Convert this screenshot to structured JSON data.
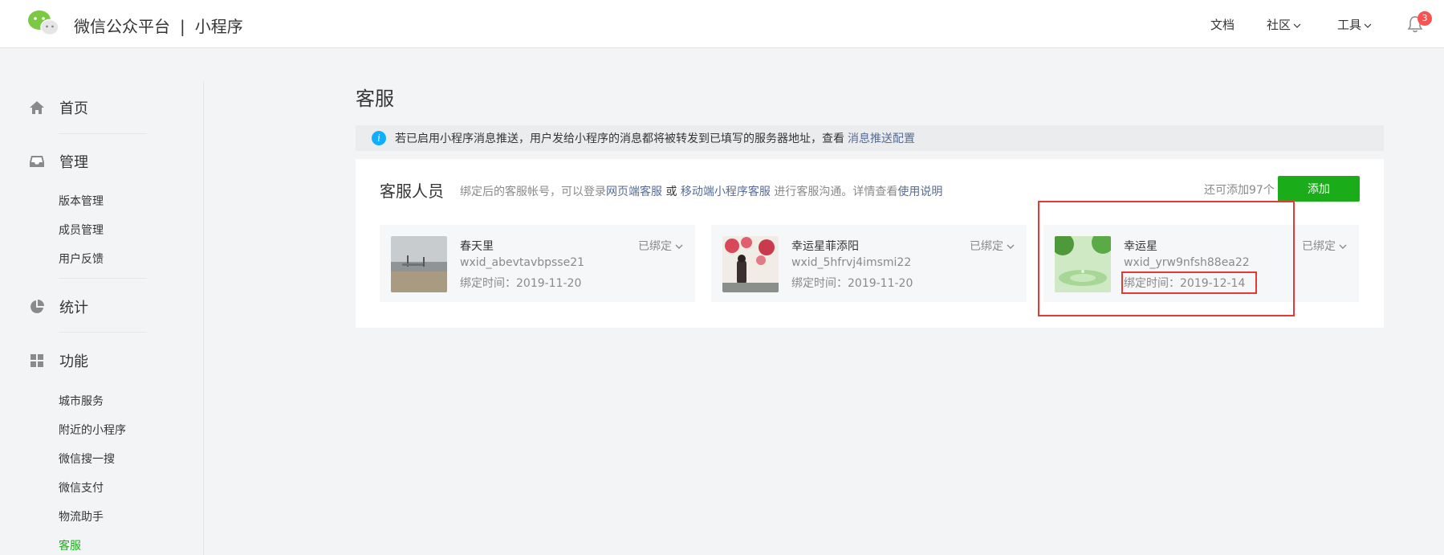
{
  "header": {
    "brand_name": "微信公众平台",
    "separator": "|",
    "product": "小程序",
    "nav": [
      "文档",
      "社区",
      "工具"
    ],
    "notification_count": "3"
  },
  "sidebar": {
    "sections": [
      {
        "label": "首页",
        "icon": "home-icon"
      },
      {
        "label": "管理",
        "icon": "inbox-icon",
        "items": [
          "版本管理",
          "成员管理",
          "用户反馈"
        ]
      },
      {
        "label": "统计",
        "icon": "pie-chart-icon"
      },
      {
        "label": "功能",
        "icon": "grid-icon",
        "items": [
          "城市服务",
          "附近的小程序",
          "微信搜一搜",
          "微信支付",
          "物流助手",
          "客服"
        ]
      }
    ],
    "active_item": "客服"
  },
  "main": {
    "title": "客服",
    "notice": {
      "text": "若已启用小程序消息推送，用户发给小程序的消息都将被转发到已填写的服务器地址，查看",
      "link": "消息推送配置"
    },
    "panel": {
      "title": "客服人员",
      "desc_prefix": "绑定后的客服帐号，可以登录",
      "desc_link1": "网页端客服",
      "desc_or": "或",
      "desc_link2": "移动端小程序客服",
      "desc_middle": "进行客服沟通。详情查看",
      "desc_link3": "使用说明",
      "remaining": "还可添加97个",
      "add_label": "添加",
      "staff": [
        {
          "name": "春天里",
          "wxid": "wxid_abevtavbpsse21",
          "bind_time": "绑定时间：2019-11-20",
          "status": "已绑定"
        },
        {
          "name": "幸运星菲添阳",
          "wxid": "wxid_5hfrvj4imsmi22",
          "bind_time": "绑定时间：2019-11-20",
          "status": "已绑定"
        },
        {
          "name": "幸运星",
          "wxid": "wxid_yrw9nfsh88ea22",
          "bind_time": "绑定时间：2019-12-14",
          "status": "已绑定"
        }
      ]
    }
  },
  "colors": {
    "accent_green": "#1aad19",
    "link_blue": "#576b95",
    "highlight_red": "#e53935",
    "info_blue": "#10aeff",
    "badge_red": "#fa5151"
  }
}
